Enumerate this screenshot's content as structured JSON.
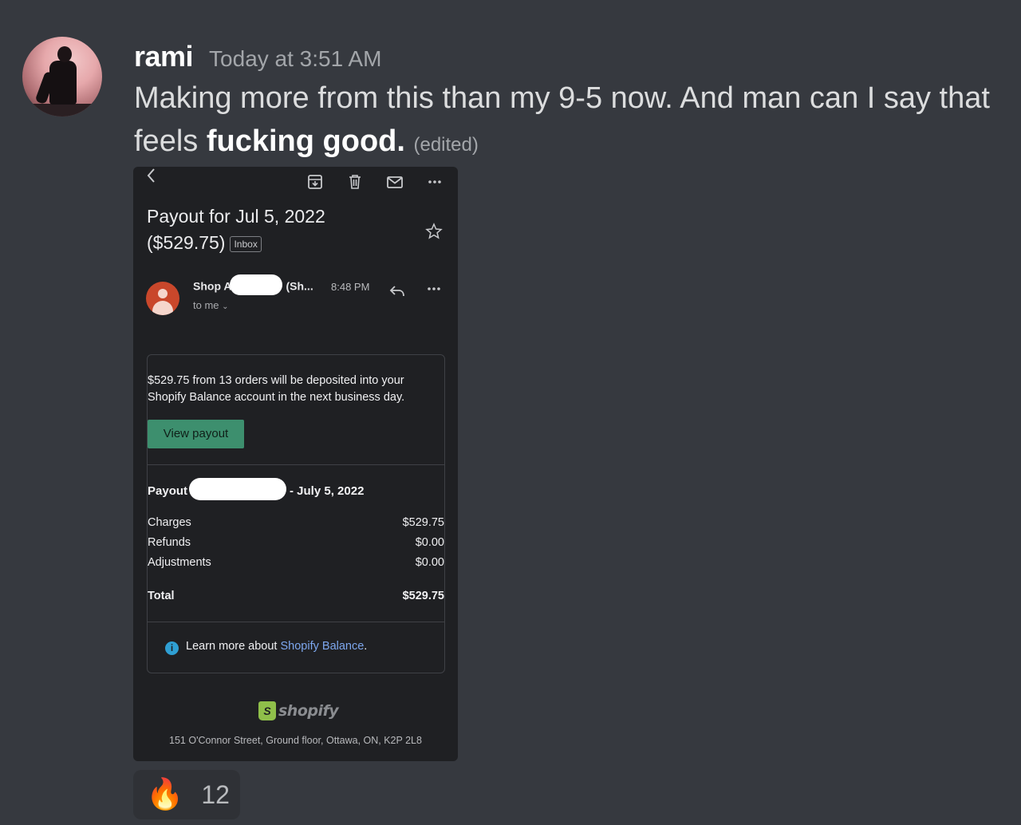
{
  "author": {
    "name": "rami",
    "timestamp": "Today at 3:51 AM"
  },
  "message": {
    "text_plain": "Making more from this than my 9-5 now. And man can I say that feels",
    "text_bold": "fucking good.",
    "edited_label": "(edited)"
  },
  "email": {
    "subject_line1": "Payout for Jul 5, 2022",
    "subject_line2": "($529.75)",
    "label_badge": "Inbox",
    "sender_prefix": "Shop A",
    "sender_suffix": "(Sh...",
    "time": "8:48 PM",
    "recipient": "to me",
    "body_text": "$529.75 from 13 orders will be deposited into your Shopify Balance account in the next business day.",
    "button_label": "View payout",
    "payout_prefix": "Payout",
    "payout_suffix": "- July 5, 2022",
    "rows": [
      {
        "label": "Charges",
        "value": "$529.75"
      },
      {
        "label": "Refunds",
        "value": "$0.00"
      },
      {
        "label": "Adjustments",
        "value": "$0.00"
      }
    ],
    "total": {
      "label": "Total",
      "value": "$529.75"
    },
    "learn_prefix": "Learn more about",
    "learn_link": "Shopify Balance",
    "learn_suffix": ".",
    "logo_word": "shopify",
    "address": "151 O'Connor Street, Ground floor, Ottawa, ON, K2P 2L8"
  },
  "reaction": {
    "emoji": "🔥",
    "count": "12"
  },
  "icons": [
    "back-icon",
    "archive-icon",
    "trash-icon",
    "mail-icon",
    "more-icon",
    "star-icon",
    "reply-icon",
    "info-icon",
    "fire-emoji"
  ]
}
